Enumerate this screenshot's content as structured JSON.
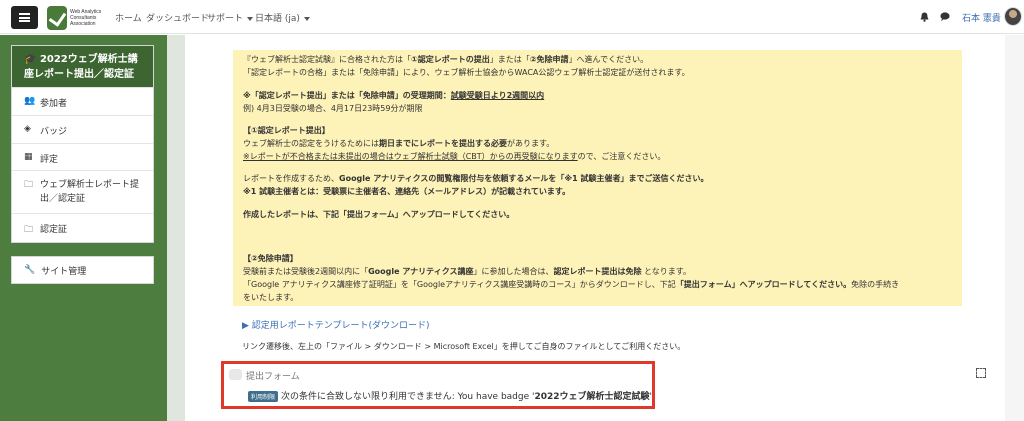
{
  "nav": {
    "logo": [
      "Web Analytics",
      "Consultants",
      "Association"
    ],
    "home": "ホーム",
    "dashboard": "ダッシュボード",
    "support": "サポート",
    "language": "日本語 (ja)",
    "user_name": "石本 憲貴"
  },
  "sidebar": {
    "course_title": "2022ウェブ解析士講座レポート提出／認定証",
    "items": [
      {
        "icon": "users-icon",
        "label": "参加者"
      },
      {
        "icon": "shield-icon",
        "label": "バッジ"
      },
      {
        "icon": "table-icon",
        "label": "評定"
      },
      {
        "icon": "folder-icon",
        "label": "ウェブ解析士レポート提出／認定証"
      },
      {
        "icon": "folder-icon",
        "label": "認定証"
      }
    ],
    "admin": "サイト管理"
  },
  "notice": {
    "l1a": "『ウェブ解析士認定試験』に合格された方は「",
    "l1b": "①認定レポートの提出",
    "l1c": "」または「",
    "l1d": "②免除申請",
    "l1e": "」へ進んでください。",
    "l2": "「認定レポートの合格」または「免除申請」により、ウェブ解析士協会からWACA公認ウェブ解析士認定証が送付されます。",
    "l3a": "※「認定レポート提出」または「免除申請」の受理期間：",
    "l3b": "試験受験日より2週間以内",
    "l4": "例) 4月3日受験の場合、4月17日23時59分が期限",
    "h1": "【①認定レポート提出】",
    "l5a": "ウェブ解析士の認定をうけるためには",
    "l5b": "期日までにレポートを提出する必要",
    "l5c": "があります。",
    "l6a": "※レポートが不合格または未提出の場合はウェブ解析士試験（CBT）からの再受験になります",
    "l6b": "ので、ご注意ください。",
    "l7a": "レポートを作成するため、",
    "l7b": "Google アナリティクスの閲覧権限付与を依頼するメールを「※1 試験主催者」までご送信ください。",
    "l8": "※1 試験主催者とは：受験票に主催者名、連絡先（メールアドレス）が記載されています。",
    "l9": "作成したレポートは、下記「提出フォーム」へアップロードしてください。",
    "h2": "【②免除申請】",
    "l10a": "受験前または受験後2週間以内に「",
    "l10b": "Google アナリティクス講座",
    "l10c": "」に参加した場合は、",
    "l10d": "認定レポート提出は免除",
    "l10e": " となります。",
    "l11a": "「Google アナリティクス講座修了証明証」を「Googleアナリティクス講座受講時のコース」からダウンロードし、下記",
    "l11b": "「提出フォーム」へアップロードしてください。",
    "l11c": "免除の手続き",
    "l12": "をいたします。"
  },
  "template_link": "▶ 認定用レポートテンプレート(ダウンロード)",
  "instruction": "リンク遷移後、左上の「ファイル > ダウンロード > Microsoft Excel」を押してご自身のファイルとしてご利用ください。",
  "form": {
    "label": "提出フォーム",
    "badge": "利用制限",
    "restriction_prefix": "次の条件に合致しない限り利用できません: You have badge '",
    "badge_name": "2022ウェブ解析士認定試験",
    "restriction_suffix": "'"
  },
  "colors": {
    "sidebar": "#4e7d40",
    "notice_bg": "#fdf2b8",
    "link": "#3a6fb0",
    "highlight_border": "#e0392b"
  }
}
